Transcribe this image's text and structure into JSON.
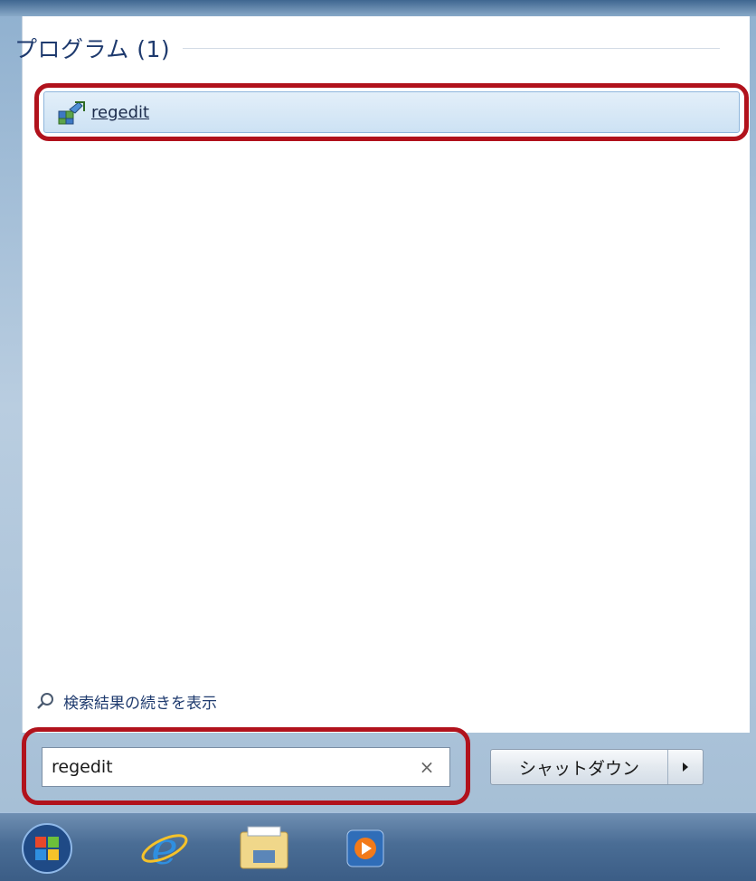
{
  "section": {
    "title": "プログラム (1)"
  },
  "result": {
    "label": "regedit",
    "icon": "registry-editor-icon"
  },
  "see_more": {
    "label": "検索結果の続きを表示"
  },
  "search": {
    "value": "regedit",
    "clear_glyph": "×"
  },
  "shutdown": {
    "label": "シャットダウン",
    "arrow_glyph": "▸"
  },
  "taskbar": {
    "items": [
      {
        "icon": "start-orb-icon"
      },
      {
        "icon": "internet-explorer-icon"
      },
      {
        "icon": "file-explorer-icon"
      },
      {
        "icon": "media-player-icon"
      }
    ]
  },
  "colors": {
    "highlight_outline": "#b1121c",
    "title_text": "#1e3a6e"
  }
}
